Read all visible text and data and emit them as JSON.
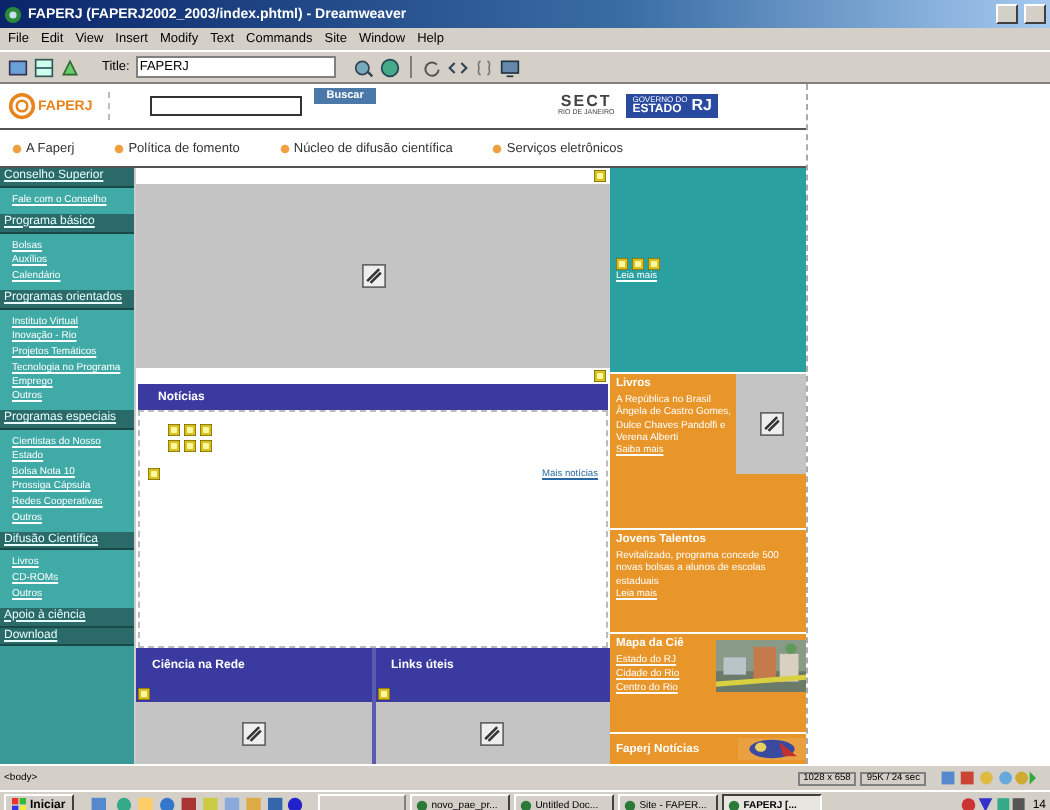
{
  "window": {
    "title": "FAPERJ (FAPERJ2002_2003/index.phtml) - Dreamweaver"
  },
  "menu": [
    "File",
    "Edit",
    "View",
    "Insert",
    "Modify",
    "Text",
    "Commands",
    "Site",
    "Window",
    "Help"
  ],
  "toolbar": {
    "title_label": "Title:",
    "title_value": "FAPERJ"
  },
  "page": {
    "logo": "FAPERJ",
    "search_button": "Buscar",
    "sect_logo": {
      "mark": "SECT",
      "caption": "RIO DE JANEIRO"
    },
    "state_logo": {
      "top": "GOVERNO DO",
      "main": "ESTADO",
      "badge": "RJ"
    },
    "nav": [
      "A Faperj",
      "Política de fomento",
      "Núcleo de difusão científica",
      "Serviços eletrônicos"
    ],
    "sidebar": [
      {
        "heading": "Conselho Superior",
        "items": [
          "Fale com o Conselho"
        ]
      },
      {
        "heading": "Programa básico",
        "items": [
          "Bolsas",
          "Auxílios",
          "Calendário"
        ]
      },
      {
        "heading": "Programas orientados",
        "items": [
          "Instituto Virtual",
          "Inovação - Rio",
          "Projetos Temáticos",
          "Tecnologia no Programa Emprego",
          "Outros"
        ]
      },
      {
        "heading": "Programas especiais",
        "items": [
          "Cientistas do Nosso Estado",
          "Bolsa Nota 10",
          "Prossiga Cápsula",
          "Redes Cooperativas",
          "Outros"
        ]
      },
      {
        "heading": "Difusão Científica",
        "items": [
          "Livros",
          "CD-ROMs",
          "Outros"
        ]
      },
      {
        "heading": "Apoio à ciência"
      },
      {
        "heading": "Download"
      }
    ],
    "news": {
      "title": "Notícias",
      "more": "Mais notícias"
    },
    "bottom_panels": [
      "Ciência na Rede",
      "Links úteis"
    ],
    "feature": {
      "link": "Leia mais"
    },
    "books": {
      "title": "Livros",
      "text": "A República no Brasil Ângela de Castro Gomes, Dulce Chaves Pandolfi e Verena Alberti",
      "link": "Saiba mais"
    },
    "talents": {
      "title": "Jovens Talentos",
      "text": "Revitalizado, programa concede 500 novas bolsas a alunos de escolas estaduais",
      "link": "Leia mais"
    },
    "map": {
      "title": "Mapa da Ciê",
      "links": [
        "Estado do RJ",
        "Cidade do Rio",
        "Centro do Rio"
      ]
    },
    "faperj_news": {
      "title": "Faperj Notícias"
    }
  },
  "status_bar": {
    "tag": "<body>",
    "size": "1028 x 658",
    "download": "95K / 24 sec"
  },
  "taskbar": {
    "start": "Iniciar",
    "tasks": [
      {
        "label": "novo_pae_pr...",
        "selected": false
      },
      {
        "label": "Untitled Doc...",
        "selected": false
      },
      {
        "label": "Site - FAPER...",
        "selected": false
      },
      {
        "label": "FAPERJ [...",
        "selected": true
      }
    ],
    "clock": "14"
  }
}
